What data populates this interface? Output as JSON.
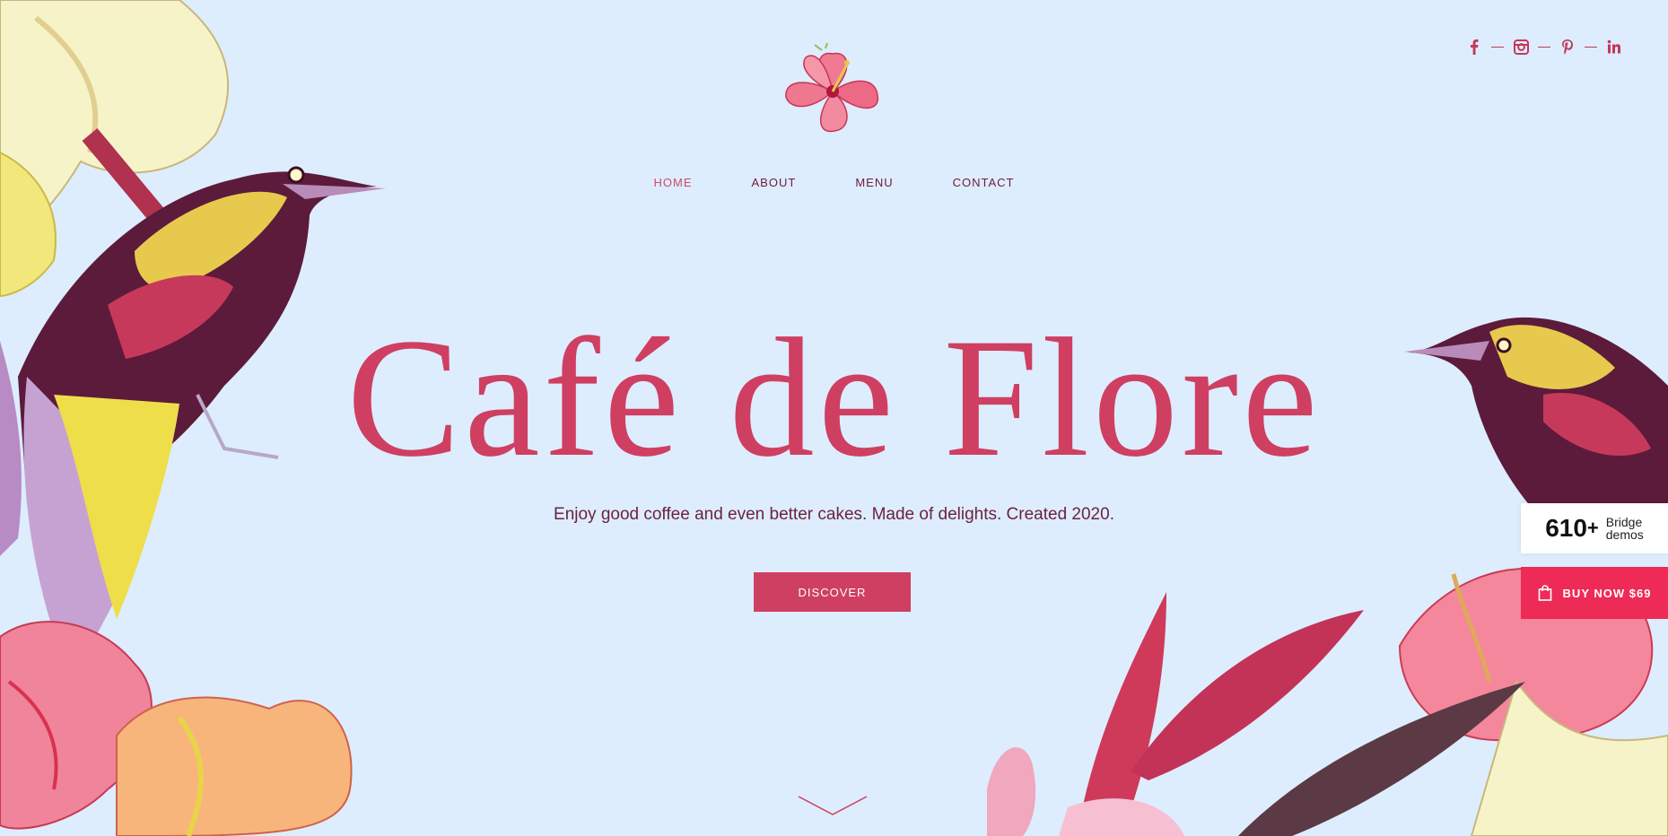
{
  "colors": {
    "background": "#ddedfd",
    "accent": "#cf3f62",
    "nav_text": "#6e1b3c",
    "buy_button": "#ee2a57"
  },
  "social": [
    {
      "icon": "facebook-icon"
    },
    {
      "icon": "instagram-icon"
    },
    {
      "icon": "pinterest-icon"
    },
    {
      "icon": "linkedin-icon"
    }
  ],
  "nav": {
    "items": [
      {
        "label": "HOME",
        "active": true
      },
      {
        "label": "ABOUT",
        "active": false
      },
      {
        "label": "MENU",
        "active": false
      },
      {
        "label": "CONTACT",
        "active": false
      }
    ]
  },
  "hero": {
    "title": "Café de Flore",
    "subtitle": "Enjoy good coffee and even better cakes. Made of delights. Created 2020.",
    "button": "DISCOVER"
  },
  "promo": {
    "count": "610",
    "plus": "+",
    "label_line1": "Bridge",
    "label_line2": "demos",
    "buy_label": "BUY NOW $69"
  }
}
